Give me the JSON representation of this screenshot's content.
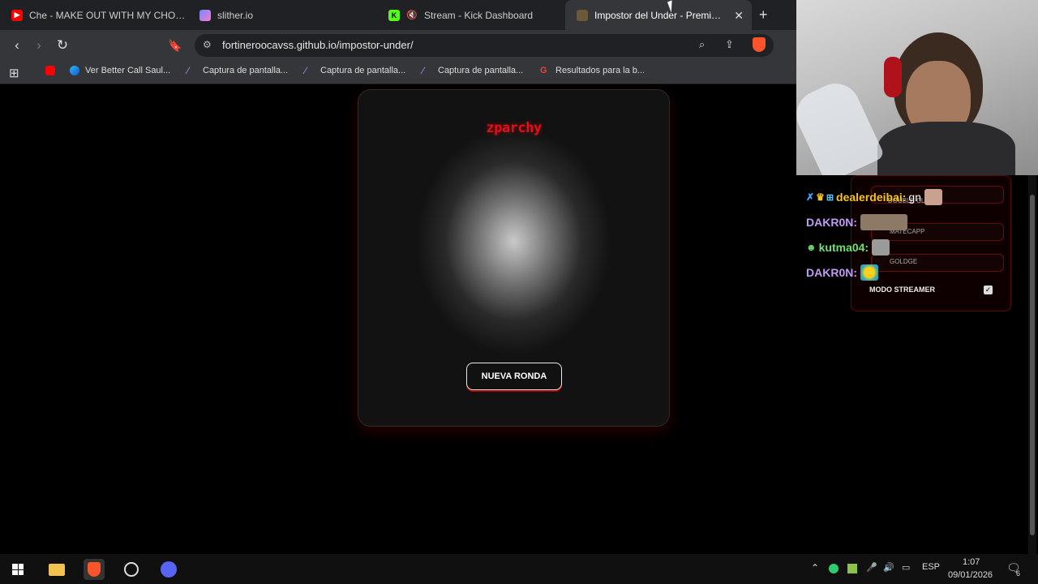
{
  "browser": {
    "tabs": [
      {
        "title": "Che - MAKE OUT WITH MY CHOPPA",
        "icon": "youtube-icon",
        "active": false
      },
      {
        "title": "slither.io",
        "icon": "slither-icon",
        "active": false
      },
      {
        "title": "Stream - Kick Dashboard",
        "icon": "kick-icon",
        "active": false
      },
      {
        "title": "Impostor del Under - Premium E",
        "icon": "game-icon",
        "active": true
      }
    ],
    "url": "fortineroocavss.github.io/impostor-under/",
    "bookmarks": [
      {
        "label": "",
        "icon": "youtube-icon"
      },
      {
        "label": "Ver Better Call Saul...",
        "icon": "edge-icon"
      },
      {
        "label": "Captura de pantalla...",
        "icon": "feather-icon"
      },
      {
        "label": "Captura de pantalla...",
        "icon": "feather-icon"
      },
      {
        "label": "Captura de pantalla...",
        "icon": "feather-icon"
      },
      {
        "label": "Resultados para la b...",
        "icon": "google-icon"
      }
    ]
  },
  "game": {
    "brand": "zparchy",
    "button_label": "NUEVA RONDA"
  },
  "chat": {
    "messages": [
      {
        "user": "dealerdeibai:",
        "text": "gn",
        "color": "#f5c518"
      },
      {
        "user": "DAKR0N:",
        "text": "",
        "color": "#c09af2"
      },
      {
        "user": "kutma04:",
        "text": "",
        "color": "#6fe06f"
      },
      {
        "user": "DAKR0N:",
        "text": "",
        "color": "#c09af2"
      }
    ],
    "overlay_items": [
      "DOUBLE CL",
      "MATECAPP",
      "GOLDGE"
    ],
    "streamer_mode_label": "MODO STREAMER",
    "streamer_mode_checked": true
  },
  "taskbar": {
    "language": "ESP",
    "time": "1:07",
    "date": "09/01/2026",
    "notification_count": "6"
  },
  "colors": {
    "accent_red": "#e0101a",
    "tab_bg": "#202124",
    "toolbar_bg": "#35363a"
  }
}
